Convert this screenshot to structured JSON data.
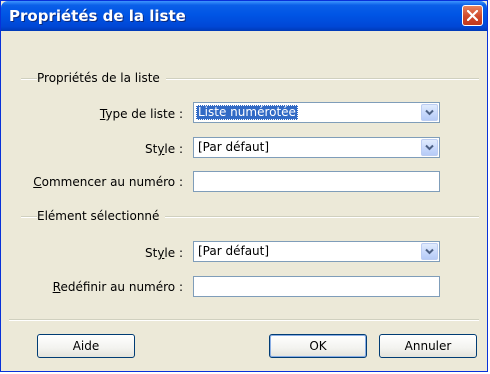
{
  "window": {
    "title": "Propriétés de la liste",
    "close_icon": "close-icon",
    "titlebar_color": "#0055e5",
    "close_color": "#d0492b"
  },
  "list_group": {
    "label": "Propriétés de la liste",
    "type": {
      "label_access": "T",
      "label_rest": "ype de liste :",
      "value": "Liste numérotée",
      "value_selected": true
    },
    "style": {
      "label_pre": "St",
      "label_access": "y",
      "label_rest": "le :",
      "value": "[Par défaut]"
    },
    "start": {
      "label_access": "C",
      "label_rest": "ommencer au numéro :",
      "value": ""
    }
  },
  "item_group": {
    "label": "Elément sélectionné",
    "style": {
      "label_pre": "St",
      "label_access": "y",
      "label_rest": "le :",
      "value": "[Par défaut]"
    },
    "reset": {
      "label_access": "R",
      "label_rest": "edéfinir au numéro :",
      "value": ""
    }
  },
  "buttons": {
    "help": "Aide",
    "ok": "OK",
    "cancel": "Annuler"
  },
  "colors": {
    "dialog_bg": "#ece9d8",
    "selection": "#316ac5",
    "field_border": "#7f9db9",
    "button_border": "#003c74"
  }
}
